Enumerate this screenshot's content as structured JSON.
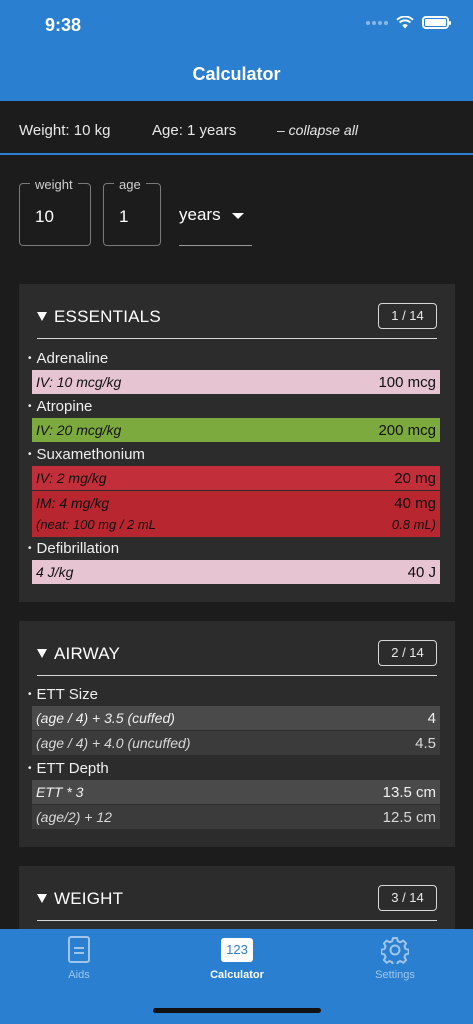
{
  "status": {
    "time": "9:38"
  },
  "nav": {
    "title": "Calculator"
  },
  "summary": {
    "weight": "Weight: 10 kg",
    "age": "Age: 1 years",
    "collapse": "– collapse all"
  },
  "inputs": {
    "weight": {
      "label": "weight",
      "value": "10"
    },
    "age": {
      "label": "age",
      "value": "1"
    },
    "unit": {
      "value": "years"
    }
  },
  "essentials": {
    "title": "ESSENTIALS",
    "badge": "1 / 14",
    "items": [
      {
        "label": "Adrenaline",
        "rows": [
          {
            "left": "IV: 10 mcg/kg",
            "right": "100 mcg"
          }
        ]
      },
      {
        "label": "Atropine",
        "rows": [
          {
            "left": "IV: 20 mcg/kg",
            "right": "200 mcg"
          }
        ]
      },
      {
        "label": "Suxamethonium",
        "rows": [
          {
            "left": "IV: 2 mg/kg",
            "right": "20 mg"
          },
          {
            "left": "IM: 4 mg/kg",
            "right": "40 mg",
            "left2": "(neat: 100 mg / 2 mL",
            "right2": "0.8 mL)"
          }
        ]
      },
      {
        "label": "Defibrillation",
        "rows": [
          {
            "left": "4 J/kg",
            "right": "40 J"
          }
        ]
      }
    ]
  },
  "airway": {
    "title": "AIRWAY",
    "badge": "2 / 14",
    "items": [
      {
        "label": "ETT Size",
        "rows": [
          {
            "left": "(age / 4) + 3.5 (cuffed)",
            "right": "4"
          },
          {
            "left": "(age / 4) + 4.0 (uncuffed)",
            "right": "4.5"
          }
        ]
      },
      {
        "label": "ETT Depth",
        "rows": [
          {
            "left": "ETT * 3",
            "right": "13.5 cm"
          },
          {
            "left": "(age/2) + 12",
            "right": "12.5 cm"
          }
        ]
      }
    ]
  },
  "weight_section": {
    "title": "WEIGHT",
    "badge": "3 / 14"
  },
  "tabs": {
    "aids": "Aids",
    "calculator": "Calculator",
    "settings": "Settings",
    "calc_icon_text": "123"
  },
  "colors": {
    "accent": "#2a7fd0",
    "pink": "#e6c4d2",
    "green": "#7daa3f",
    "red": "#c22e3a"
  }
}
